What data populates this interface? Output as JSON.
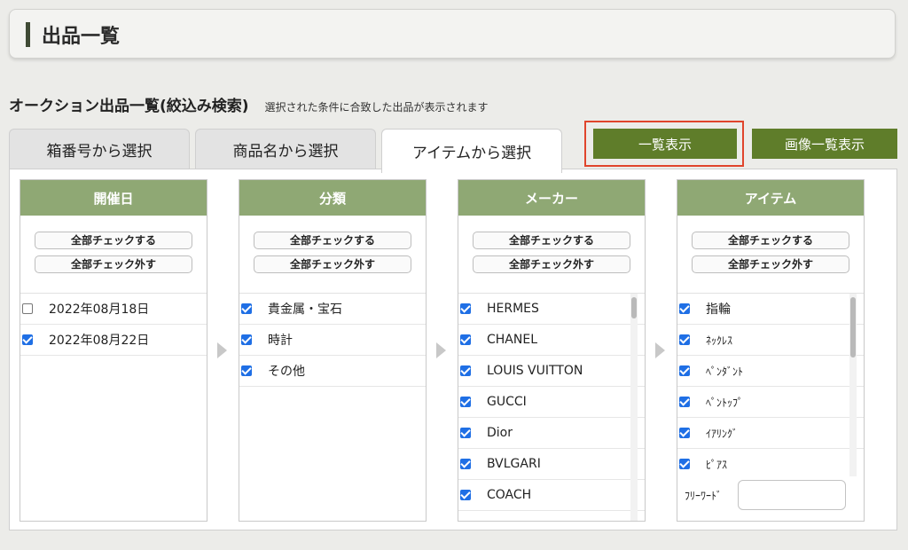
{
  "page": {
    "title": "出品一覧"
  },
  "section": {
    "heading": "オークション出品一覧(絞込み検索)",
    "description": "選択された条件に合致した出品が表示されます"
  },
  "tabs": [
    {
      "label": "箱番号から選択",
      "active": false
    },
    {
      "label": "商品名から選択",
      "active": false
    },
    {
      "label": "アイテムから選択",
      "active": true
    }
  ],
  "actions": {
    "list_view": "一覧表示",
    "image_list_view": "画像一覧表示"
  },
  "colors": {
    "button_green": "#5f7d2a",
    "column_header": "#8fa874",
    "highlight": "#e0452c",
    "checkbox": "#1f6fe5"
  },
  "common": {
    "check_all": "全部チェックする",
    "uncheck_all": "全部チェック外す"
  },
  "columns": {
    "date": {
      "header": "開催日",
      "items": [
        {
          "label": "2022年08月18日",
          "checked": false
        },
        {
          "label": "2022年08月22日",
          "checked": true
        }
      ]
    },
    "category": {
      "header": "分類",
      "items": [
        {
          "label": "貴金属・宝石",
          "checked": true
        },
        {
          "label": "時計",
          "checked": true
        },
        {
          "label": "その他",
          "checked": true
        }
      ]
    },
    "maker": {
      "header": "メーカー",
      "items": [
        {
          "label": "HERMES",
          "checked": true
        },
        {
          "label": "CHANEL",
          "checked": true
        },
        {
          "label": "LOUIS VUITTON",
          "checked": true
        },
        {
          "label": "GUCCI",
          "checked": true
        },
        {
          "label": "Dior",
          "checked": true
        },
        {
          "label": "BVLGARI",
          "checked": true
        },
        {
          "label": "COACH",
          "checked": true
        }
      ]
    },
    "item": {
      "header": "アイテム",
      "items": [
        {
          "label": "指輪",
          "checked": true
        },
        {
          "label": "ﾈｯｸﾚｽ",
          "checked": true
        },
        {
          "label": "ﾍﾟﾝﾀﾞﾝﾄ",
          "checked": true
        },
        {
          "label": "ﾍﾟﾝﾄｯﾌﾟ",
          "checked": true
        },
        {
          "label": "ｲｱﾘﾝｸﾞ",
          "checked": true
        },
        {
          "label": "ﾋﾟｱｽ",
          "checked": true
        }
      ],
      "freeword_label": "ﾌﾘｰﾜｰﾄﾞ",
      "freeword_value": ""
    }
  }
}
